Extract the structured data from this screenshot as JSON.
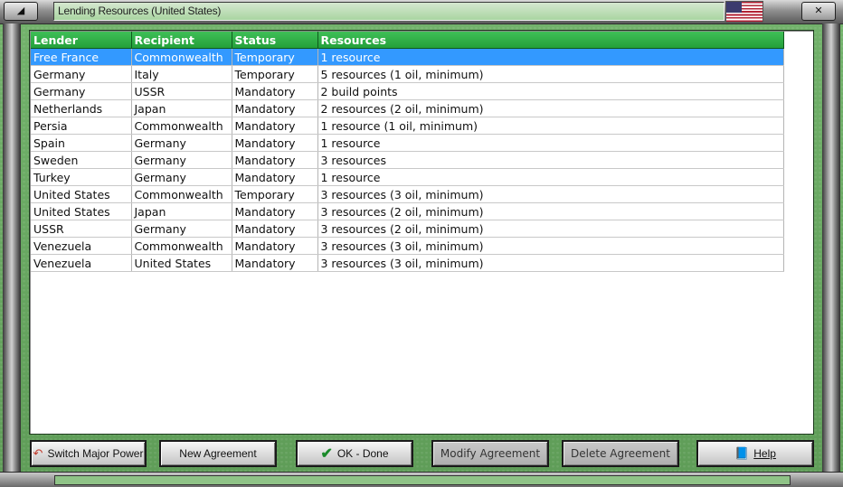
{
  "window": {
    "title": "Lending Resources (United States)",
    "flag": "us-flag-icon"
  },
  "table": {
    "headers": [
      "Lender",
      "Recipient",
      "Status",
      "Resources"
    ],
    "rows": [
      [
        "Free France",
        "Commonwealth",
        "Temporary",
        "1 resource"
      ],
      [
        "Germany",
        "Italy",
        "Temporary",
        "5 resources (1 oil, minimum)"
      ],
      [
        "Germany",
        "USSR",
        "Mandatory",
        "2 build points"
      ],
      [
        "Netherlands",
        "Japan",
        "Mandatory",
        "2 resources (2 oil, minimum)"
      ],
      [
        "Persia",
        "Commonwealth",
        "Mandatory",
        "1 resource (1 oil, minimum)"
      ],
      [
        "Spain",
        "Germany",
        "Mandatory",
        "1 resource"
      ],
      [
        "Sweden",
        "Germany",
        "Mandatory",
        "3 resources"
      ],
      [
        "Turkey",
        "Germany",
        "Mandatory",
        "1 resource"
      ],
      [
        "United States",
        "Commonwealth",
        "Temporary",
        "3 resources (3 oil, minimum)"
      ],
      [
        "United States",
        "Japan",
        "Mandatory",
        "3 resources (2 oil, minimum)"
      ],
      [
        "USSR",
        "Germany",
        "Mandatory",
        "3 resources (2 oil, minimum)"
      ],
      [
        "Venezuela",
        "Commonwealth",
        "Mandatory",
        "3 resources (3 oil, minimum)"
      ],
      [
        "Venezuela",
        "United States",
        "Mandatory",
        "3 resources (3 oil, minimum)"
      ]
    ],
    "selected_row": 0
  },
  "buttons": {
    "switch": "Switch Major Power",
    "new": "New Agreement",
    "ok": "OK - Done",
    "modify": "Modify Agreement",
    "delete": "Delete Agreement",
    "help": "Help"
  },
  "colors": {
    "header_green": "#2aa843",
    "selection_blue": "#3399ff",
    "frame_green": "#6aab62"
  }
}
